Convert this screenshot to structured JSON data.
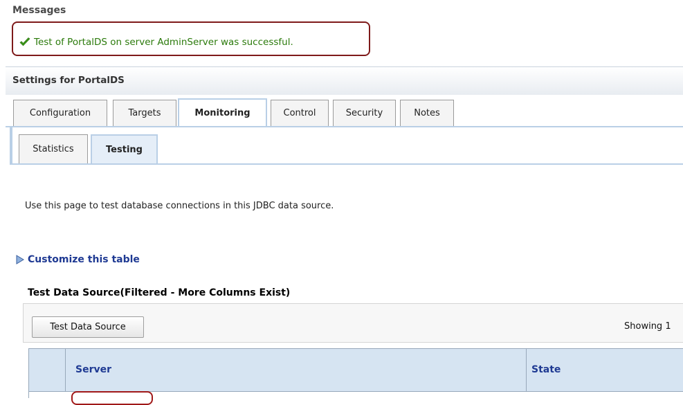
{
  "messages": {
    "heading": "Messages",
    "success_text": "Test of PortalDS on server AdminServer was successful.",
    "success_color": "#2b7a0b"
  },
  "settings": {
    "title": "Settings for PortalDS"
  },
  "tabs": [
    {
      "label": "Configuration",
      "active": false
    },
    {
      "label": "Targets",
      "active": false
    },
    {
      "label": "Monitoring",
      "active": true
    },
    {
      "label": "Control",
      "active": false
    },
    {
      "label": "Security",
      "active": false
    },
    {
      "label": "Notes",
      "active": false
    }
  ],
  "subtabs": [
    {
      "label": "Statistics",
      "active": false
    },
    {
      "label": "Testing",
      "active": true
    }
  ],
  "intro_text": "Use this page to test database connections in this JDBC data source.",
  "customize_link": "Customize this table",
  "table": {
    "caption": "Test Data Source(Filtered - More Columns Exist)",
    "button_label": "Test Data Source",
    "showing_text": "Showing 1",
    "columns": [
      "Server",
      "State"
    ]
  },
  "icons": {
    "success": "checkmark-icon",
    "expand": "expand-triangle-icon"
  }
}
